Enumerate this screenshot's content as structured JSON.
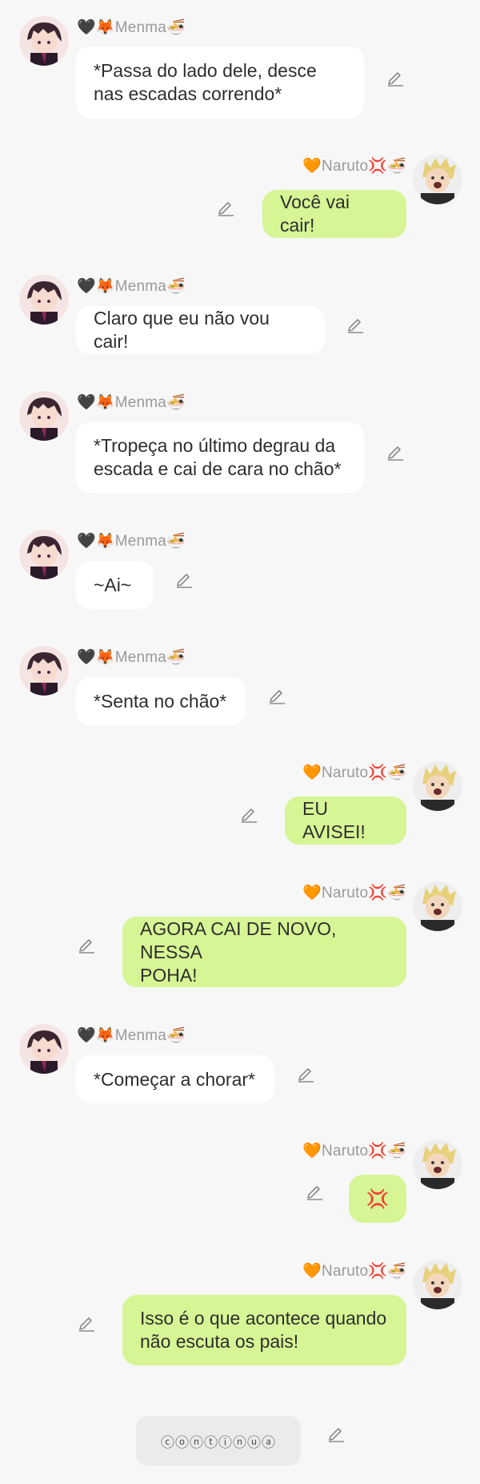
{
  "names": {
    "menma": "🖤🦊Menma🍜",
    "naruto": "🧡Naruto💢🍜"
  },
  "messages": [
    {
      "sender": "menma",
      "text": "*Passa do lado dele, desce\nnas escadas correndo*"
    },
    {
      "sender": "naruto",
      "text": "Você vai cair!"
    },
    {
      "sender": "menma",
      "text": "Claro que eu não vou cair!"
    },
    {
      "sender": "menma",
      "text": "*Tropeça no último degrau da\nescada e cai de cara no chão*"
    },
    {
      "sender": "menma",
      "text": "~Ai~"
    },
    {
      "sender": "menma",
      "text": "*Senta no chão*"
    },
    {
      "sender": "naruto",
      "text": "EU AVISEI!"
    },
    {
      "sender": "naruto",
      "text": "AGORA CAI DE NOVO, NESSA\nPOHA!"
    },
    {
      "sender": "menma",
      "text": "*Começar a chorar*"
    },
    {
      "sender": "naruto",
      "text": "💢"
    },
    {
      "sender": "naruto",
      "text": "Isso é o que acontece quando\nnão escuta os pais!"
    }
  ],
  "continua_label": "ⓒⓞⓝⓣⓘⓝⓤⓐ",
  "icons": {
    "edit": "pencil-icon",
    "avatar_menma": "dark-haired-character-avatar",
    "avatar_naruto": "blond-character-avatar"
  },
  "colors": {
    "background": "#f7f7f7",
    "incoming_bubble": "#ffffff",
    "outgoing_bubble": "#d6f594",
    "name_text": "#9a9a9a"
  }
}
